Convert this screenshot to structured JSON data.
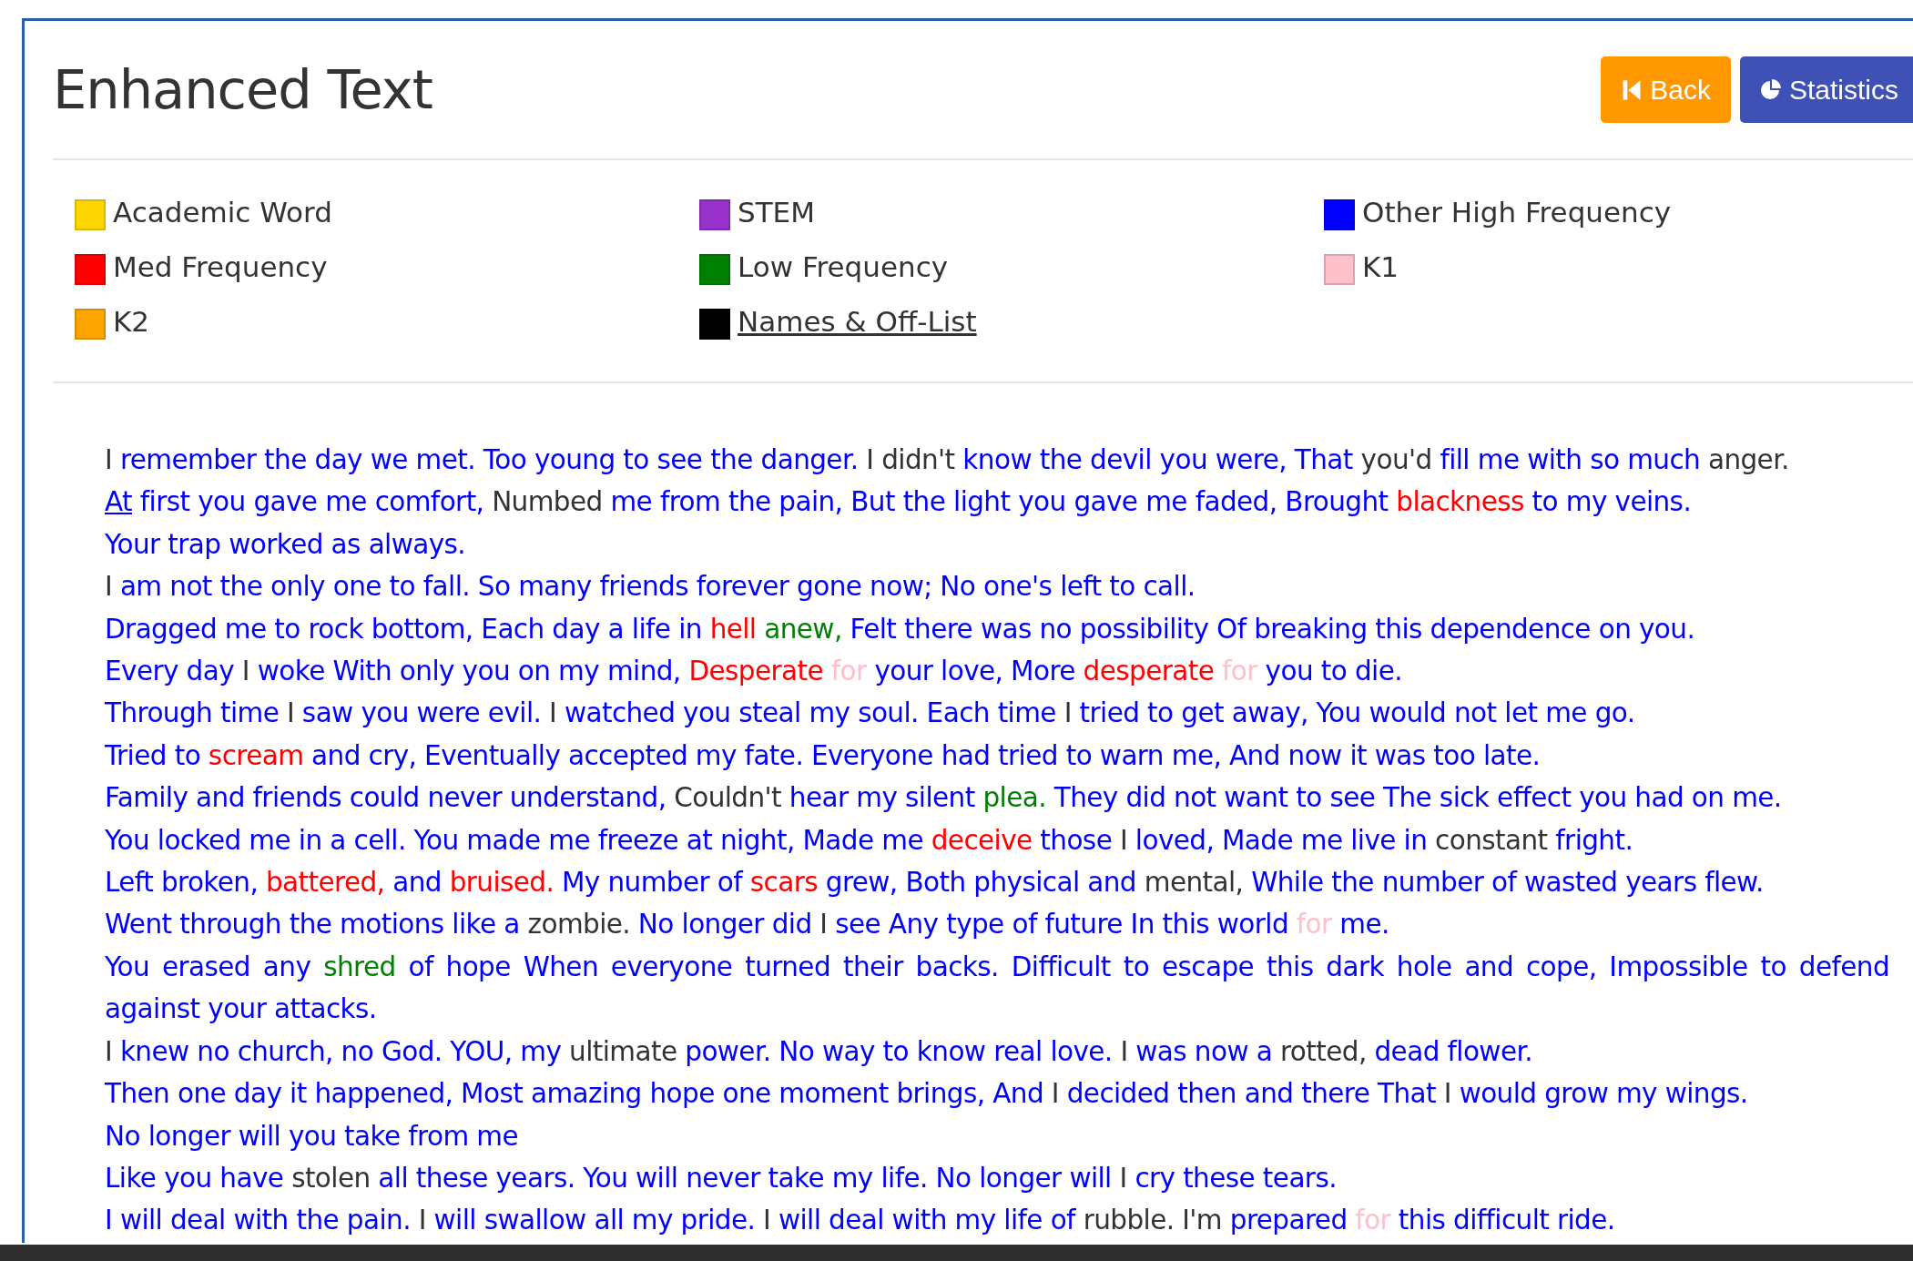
{
  "title": "Enhanced Text",
  "buttons": [
    {
      "kind": "back",
      "label": "Back"
    },
    {
      "kind": "stats",
      "label": "Statistics"
    }
  ],
  "legend": [
    {
      "kind": "academic",
      "label": "Academic Word",
      "color": "#ffd700",
      "underline": false
    },
    {
      "kind": "stem",
      "label": "STEM",
      "color": "#9932cc",
      "underline": false
    },
    {
      "kind": "high",
      "label": "Other High Frequency",
      "color": "#0000ff",
      "underline": false
    },
    {
      "kind": "med",
      "label": "Med Frequency",
      "color": "#ff0000",
      "underline": false
    },
    {
      "kind": "low",
      "label": "Low Frequency",
      "color": "#008000",
      "underline": false
    },
    {
      "kind": "k1",
      "label": "K1",
      "color": "#ffc0cb",
      "underline": false
    },
    {
      "kind": "k2",
      "label": "K2",
      "color": "#ffa500",
      "underline": false
    },
    {
      "kind": "off",
      "label": "Names & Off-List",
      "color": "#000000",
      "underline": true
    }
  ],
  "lines": [
    [
      {
        "kind": "off",
        "text": "I "
      },
      {
        "kind": "high",
        "text": "remember the day we met. Too young to see the danger."
      },
      {
        "kind": "off",
        "text": " I didn't "
      },
      {
        "kind": "high",
        "text": "know the devil you were, That"
      },
      {
        "kind": "off",
        "text": " you'd "
      },
      {
        "kind": "high",
        "text": "fill me with so much"
      },
      {
        "kind": "off",
        "text": " anger."
      }
    ],
    [
      {
        "kind": "high",
        "text": "At",
        "underline": true
      },
      {
        "kind": "high",
        "text": " first you gave me comfort,"
      },
      {
        "kind": "off",
        "text": " Numbed "
      },
      {
        "kind": "high",
        "text": "me from the pain, But the light you gave me faded, Brought "
      },
      {
        "kind": "med",
        "text": "blackness"
      },
      {
        "kind": "high",
        "text": " to my veins."
      }
    ],
    [
      {
        "kind": "high",
        "text": "Your trap worked as always."
      }
    ],
    [
      {
        "kind": "off",
        "text": "I "
      },
      {
        "kind": "high",
        "text": "am not the only one to fall. So many friends forever gone now; No one's left to call."
      }
    ],
    [
      {
        "kind": "high",
        "text": "Dragged me to rock bottom, Each day a life in "
      },
      {
        "kind": "med",
        "text": "hell"
      },
      {
        "kind": "low",
        "text": " anew,"
      },
      {
        "kind": "high",
        "text": " Felt there was no possibility Of breaking this dependence on you."
      }
    ],
    [
      {
        "kind": "high",
        "text": "Every day "
      },
      {
        "kind": "off",
        "text": "I "
      },
      {
        "kind": "high",
        "text": "woke With only you on my mind, "
      },
      {
        "kind": "med",
        "text": "Desperate"
      },
      {
        "kind": "k1",
        "text": " for "
      },
      {
        "kind": "high",
        "text": "your love, More "
      },
      {
        "kind": "med",
        "text": "desperate"
      },
      {
        "kind": "k1",
        "text": " for "
      },
      {
        "kind": "high",
        "text": "you to die."
      }
    ],
    [
      {
        "kind": "high",
        "text": "Through time "
      },
      {
        "kind": "off",
        "text": "I "
      },
      {
        "kind": "high",
        "text": "saw you were evil. "
      },
      {
        "kind": "off",
        "text": "I "
      },
      {
        "kind": "high",
        "text": "watched you steal my soul. Each time "
      },
      {
        "kind": "off",
        "text": "I "
      },
      {
        "kind": "high",
        "text": "tried to get away, You would not let me go."
      }
    ],
    [
      {
        "kind": "high",
        "text": "Tried to "
      },
      {
        "kind": "med",
        "text": "scream"
      },
      {
        "kind": "high",
        "text": " and cry, Eventually accepted my fate. Everyone had tried to warn me, And now it was too late."
      }
    ],
    [
      {
        "kind": "high",
        "text": "Family and friends could never understand,"
      },
      {
        "kind": "off",
        "text": " Couldn't "
      },
      {
        "kind": "high",
        "text": "hear my silent "
      },
      {
        "kind": "low",
        "text": "plea."
      },
      {
        "kind": "high",
        "text": " They did not want to see The sick effect you had on me."
      }
    ],
    [
      {
        "kind": "high",
        "text": "You locked me in a cell. You made me freeze at night, Made me "
      },
      {
        "kind": "med",
        "text": "deceive"
      },
      {
        "kind": "high",
        "text": " those "
      },
      {
        "kind": "off",
        "text": "I "
      },
      {
        "kind": "high",
        "text": "loved, Made me live in"
      },
      {
        "kind": "off",
        "text": " constant "
      },
      {
        "kind": "high",
        "text": "fright."
      }
    ],
    [
      {
        "kind": "high",
        "text": "Left broken, "
      },
      {
        "kind": "med",
        "text": "battered,"
      },
      {
        "kind": "high",
        "text": " and "
      },
      {
        "kind": "med",
        "text": "bruised."
      },
      {
        "kind": "high",
        "text": " My number of "
      },
      {
        "kind": "med",
        "text": "scars"
      },
      {
        "kind": "high",
        "text": " grew, Both physical and"
      },
      {
        "kind": "off",
        "text": " mental, "
      },
      {
        "kind": "high",
        "text": "While the number of wasted years flew."
      }
    ],
    [
      {
        "kind": "high",
        "text": "Went through the motions like a"
      },
      {
        "kind": "off",
        "text": " zombie. "
      },
      {
        "kind": "high",
        "text": "No longer did "
      },
      {
        "kind": "off",
        "text": "I "
      },
      {
        "kind": "high",
        "text": "see Any type of future In this world "
      },
      {
        "kind": "k1",
        "text": "for"
      },
      {
        "kind": "high",
        "text": " me."
      }
    ],
    [
      {
        "kind": "high",
        "text": "You erased any "
      },
      {
        "kind": "low",
        "text": "shred"
      },
      {
        "kind": "high",
        "text": " of hope When everyone turned their backs. Difficult to escape this dark hole and cope, Impossible to defend against your attacks."
      }
    ],
    [
      {
        "kind": "off",
        "text": "I "
      },
      {
        "kind": "high",
        "text": "knew no church, no God. YOU, my"
      },
      {
        "kind": "off",
        "text": " ultimate "
      },
      {
        "kind": "high",
        "text": "power. No way to know real love. "
      },
      {
        "kind": "off",
        "text": "I "
      },
      {
        "kind": "high",
        "text": "was now a"
      },
      {
        "kind": "off",
        "text": " rotted, "
      },
      {
        "kind": "high",
        "text": "dead flower."
      }
    ],
    [
      {
        "kind": "high",
        "text": "Then one day it happened, Most amazing hope one moment brings, And "
      },
      {
        "kind": "off",
        "text": "I "
      },
      {
        "kind": "high",
        "text": "decided then and there That "
      },
      {
        "kind": "off",
        "text": "I "
      },
      {
        "kind": "high",
        "text": "would grow my wings."
      }
    ],
    [
      {
        "kind": "high",
        "text": "No longer will you take from me"
      }
    ],
    [
      {
        "kind": "high",
        "text": "Like you have"
      },
      {
        "kind": "off",
        "text": " stolen "
      },
      {
        "kind": "high",
        "text": "all these years. You will never take my life. No longer will "
      },
      {
        "kind": "off",
        "text": "I "
      },
      {
        "kind": "high",
        "text": "cry these tears."
      }
    ],
    [
      {
        "kind": "high",
        "text": "I will deal with the pain."
      },
      {
        "kind": "off",
        "text": " I "
      },
      {
        "kind": "high",
        "text": "will swallow all my pride. "
      },
      {
        "kind": "off",
        "text": "I "
      },
      {
        "kind": "high",
        "text": "will deal with my life of"
      },
      {
        "kind": "off",
        "text": " rubble. I'm "
      },
      {
        "kind": "high",
        "text": "prepared "
      },
      {
        "kind": "k1",
        "text": "for"
      },
      {
        "kind": "high",
        "text": " this difficult ride."
      }
    ]
  ]
}
